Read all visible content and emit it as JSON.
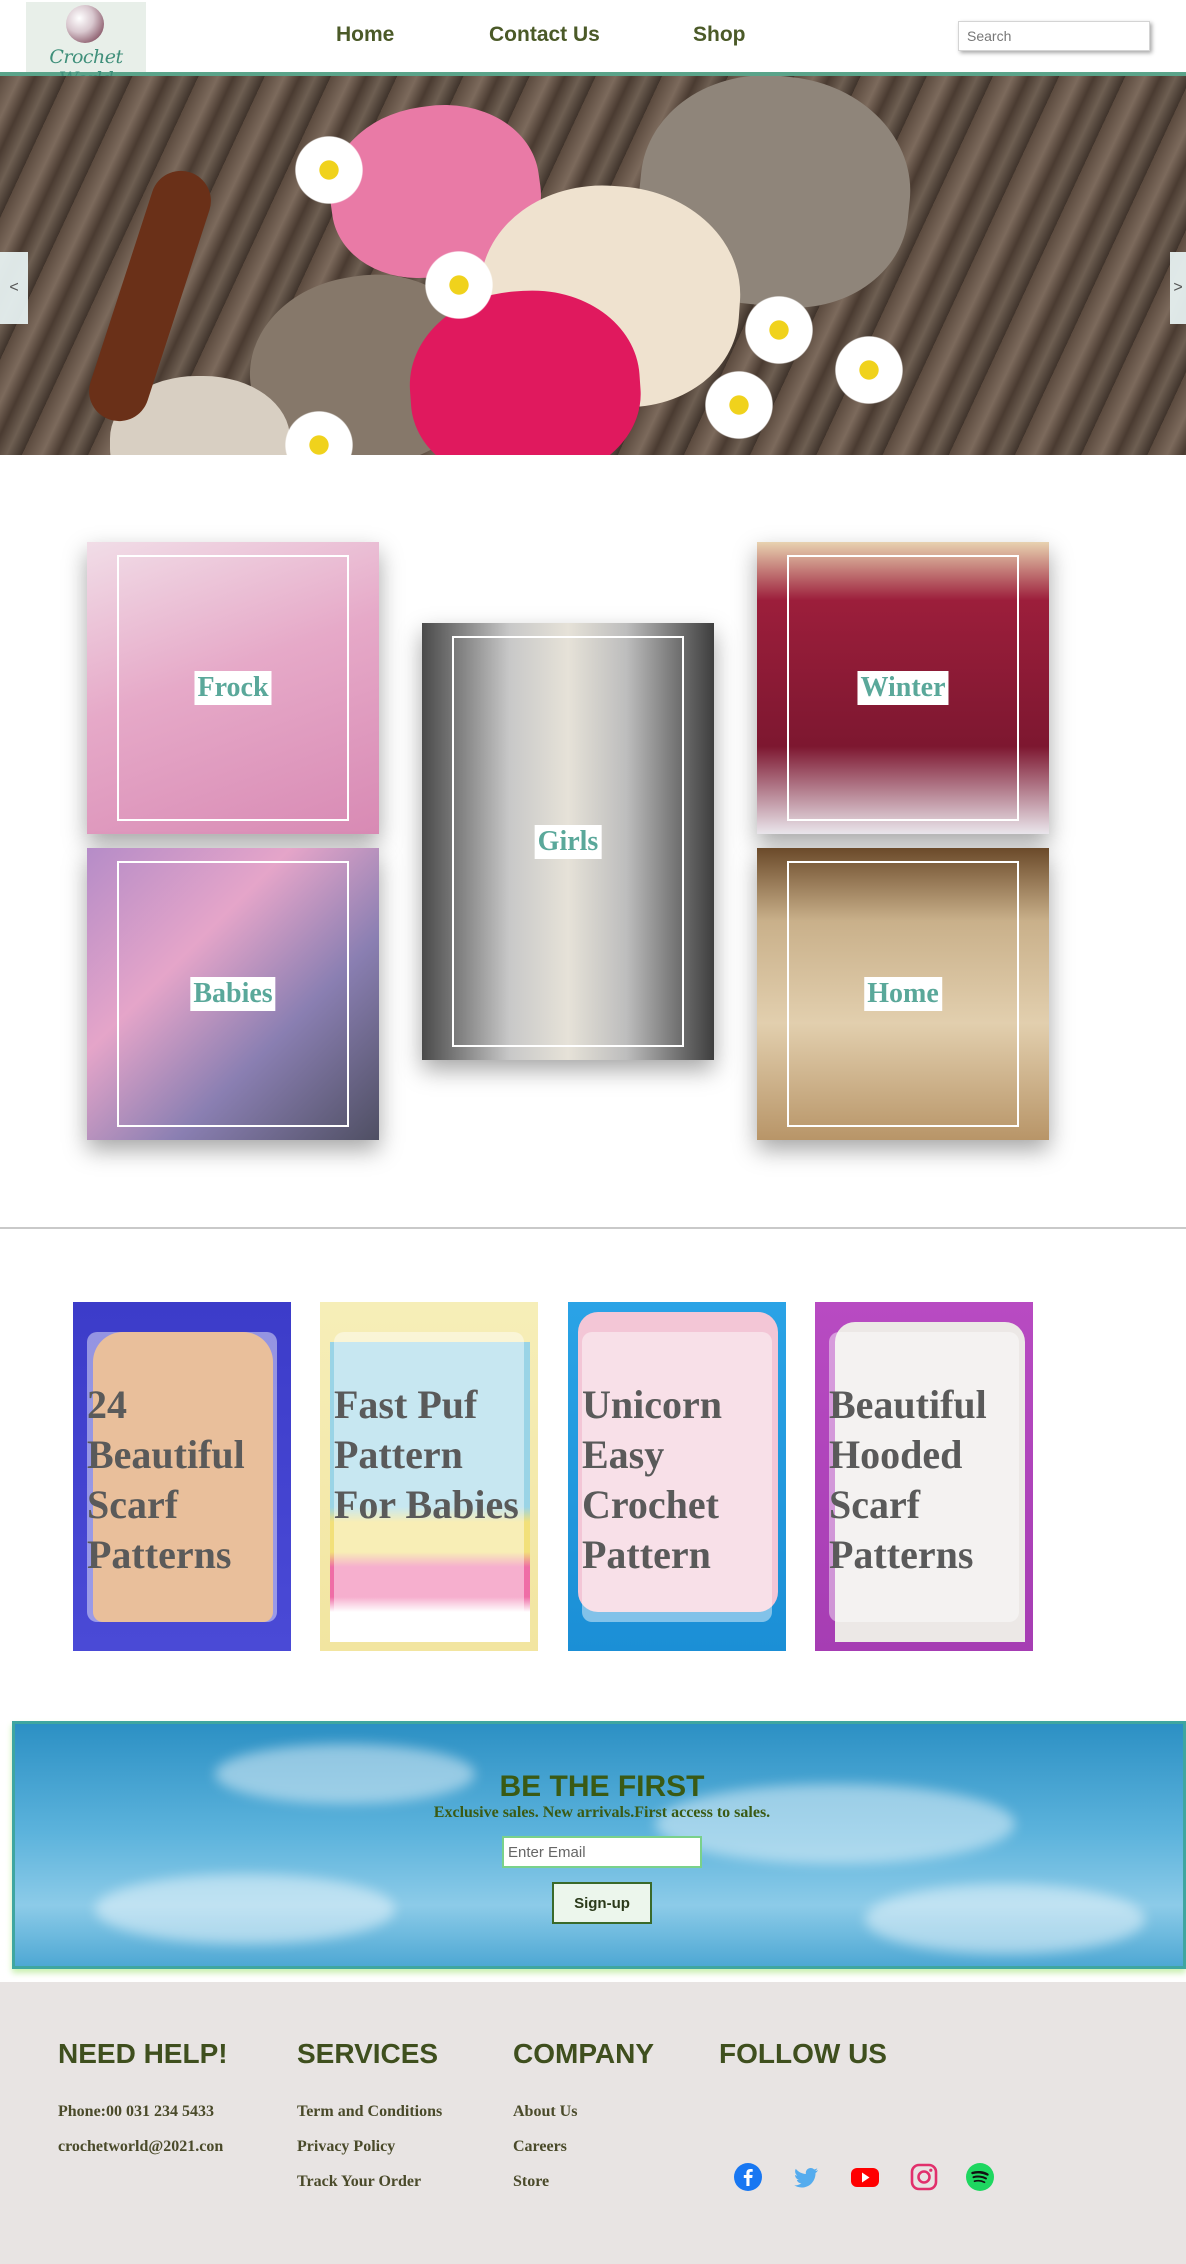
{
  "header": {
    "logo_text": "Crochet World",
    "nav": [
      "Home",
      "Contact Us",
      "Shop"
    ],
    "search_placeholder": "Search"
  },
  "hero": {
    "prev_label": "<",
    "next_label": ">"
  },
  "categories": [
    "Frock",
    "Girls",
    "Winter",
    "Babies",
    "Home"
  ],
  "patterns": [
    "24 Beautiful Scarf Patterns",
    "Fast Puf Pattern For Babies",
    "Unicorn Easy Crochet Pattern",
    "Beautiful Hooded Scarf Patterns"
  ],
  "newsletter": {
    "title": "BE THE FIRST",
    "subtitle": "Exclusive sales. New arrivals.First access to sales.",
    "email_placeholder": "Enter Email",
    "button_label": "Sign-up"
  },
  "footer": {
    "help": {
      "heading": "NEED HELP!",
      "phone": "Phone:00 031 234 5433",
      "email": "crochetworld@2021.con"
    },
    "services": {
      "heading": "SERVICES",
      "links": [
        "Term and Conditions",
        "Privacy Policy",
        "Track Your Order"
      ]
    },
    "company": {
      "heading": "COMPANY",
      "links": [
        "About Us",
        "Careers",
        "Store"
      ]
    },
    "follow": {
      "heading": "FOLLOW US",
      "icons": [
        "facebook-icon",
        "twitter-icon",
        "youtube-icon",
        "instagram-icon",
        "spotify-icon"
      ]
    }
  },
  "colors": {
    "accent": "#5aa48a",
    "nav_text": "#4b5a28",
    "category_label": "#5aa89a",
    "facebook": "#1877f2",
    "twitter": "#55acee",
    "youtube": "#ff0000",
    "instagram": "#e1306c",
    "spotify": "#1ed760"
  }
}
